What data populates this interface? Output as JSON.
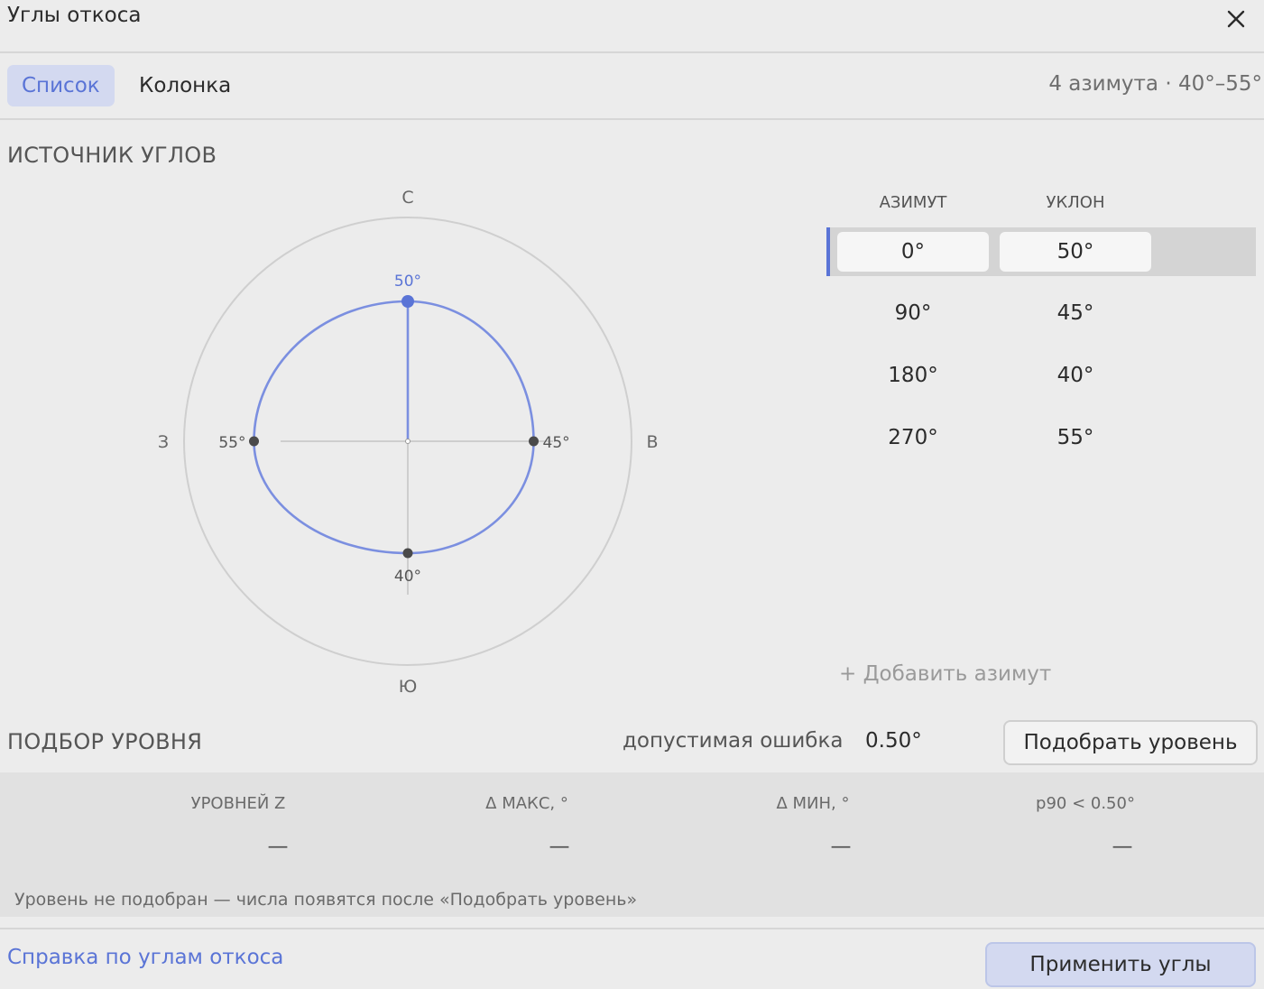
{
  "window": {
    "title": "Углы откоса"
  },
  "tabs": [
    {
      "label": "Список",
      "active": true
    },
    {
      "label": "Колонка",
      "active": false
    }
  ],
  "summary": "4 азимута · 40°–55°",
  "source": {
    "heading": "ИСТОЧНИК УГЛОВ",
    "compass": {
      "north": "С",
      "east": "В",
      "south": "Ю",
      "west": "З"
    },
    "table": {
      "col_azimuth": "АЗИМУТ",
      "col_slope": "УКЛОН",
      "rows": [
        {
          "azimuth": "0°",
          "slope": "50°",
          "azimuth_value": 0,
          "slope_value": 50,
          "selected": true
        },
        {
          "azimuth": "90°",
          "slope": "45°",
          "azimuth_value": 90,
          "slope_value": 45
        },
        {
          "azimuth": "180°",
          "slope": "40°",
          "azimuth_value": 180,
          "slope_value": 40
        },
        {
          "azimuth": "270°",
          "slope": "55°",
          "azimuth_value": 270,
          "slope_value": 55
        }
      ]
    },
    "add_label": "+ Добавить азимут"
  },
  "level": {
    "heading": "ПОДБОР УРОВНЯ",
    "tolerance_label": "допустимая ошибка",
    "tolerance_value": "0.50°",
    "fit_button": "Подобрать уровень",
    "stats_headers": [
      "УРОВНЕЙ Z",
      "Δ МАКС, °",
      "Δ МИН, °",
      "p90 < 0.50°"
    ],
    "stats_values": [
      "—",
      "—",
      "—",
      "—"
    ],
    "note": "Уровень не подобран — числа появятся после «Подобрать уровень»"
  },
  "footer": {
    "help_link": "Справка по углам откоса",
    "apply_button": "Применить углы"
  },
  "colors": {
    "accent": "#5a74d6",
    "curve": "#7b8fe0"
  }
}
